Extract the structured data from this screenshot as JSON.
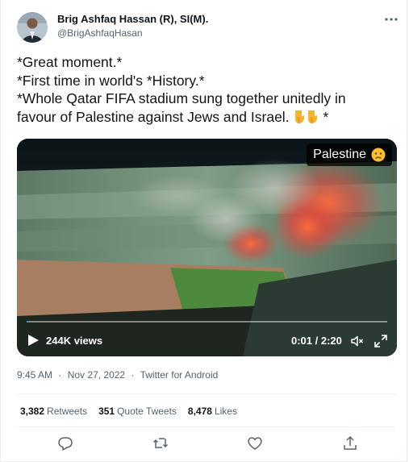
{
  "author": {
    "name": "Brig Ashfaq Hassan (R), SI(M).",
    "handle": "@BrigAshfaqHasan"
  },
  "menu_icon": "more-horizontal-icon",
  "tweet_lines": [
    "*Great moment.*",
    "*First time in world's *History.*",
    "*Whole Qatar FIFA stadium sung together unitedly in",
    "favour of Palestine against Jews and Israel."
  ],
  "tweet_trailing": "*",
  "video": {
    "overlay_text": "Palestine",
    "views": "244K views",
    "timecode": "0:01 / 2:20",
    "progress_fraction": 0.007,
    "accent": "#1d9bf0"
  },
  "meta": {
    "time": "9:45 AM",
    "date": "Nov 27, 2022",
    "separator": "·",
    "source": "Twitter for Android"
  },
  "stats": {
    "retweets_num": "3,382",
    "retweets_lbl": "Retweets",
    "quotes_num": "351",
    "quotes_lbl": "Quote Tweets",
    "likes_num": "8,478",
    "likes_lbl": "Likes"
  },
  "actions": [
    "reply-icon",
    "retweet-icon",
    "like-icon",
    "share-icon"
  ]
}
